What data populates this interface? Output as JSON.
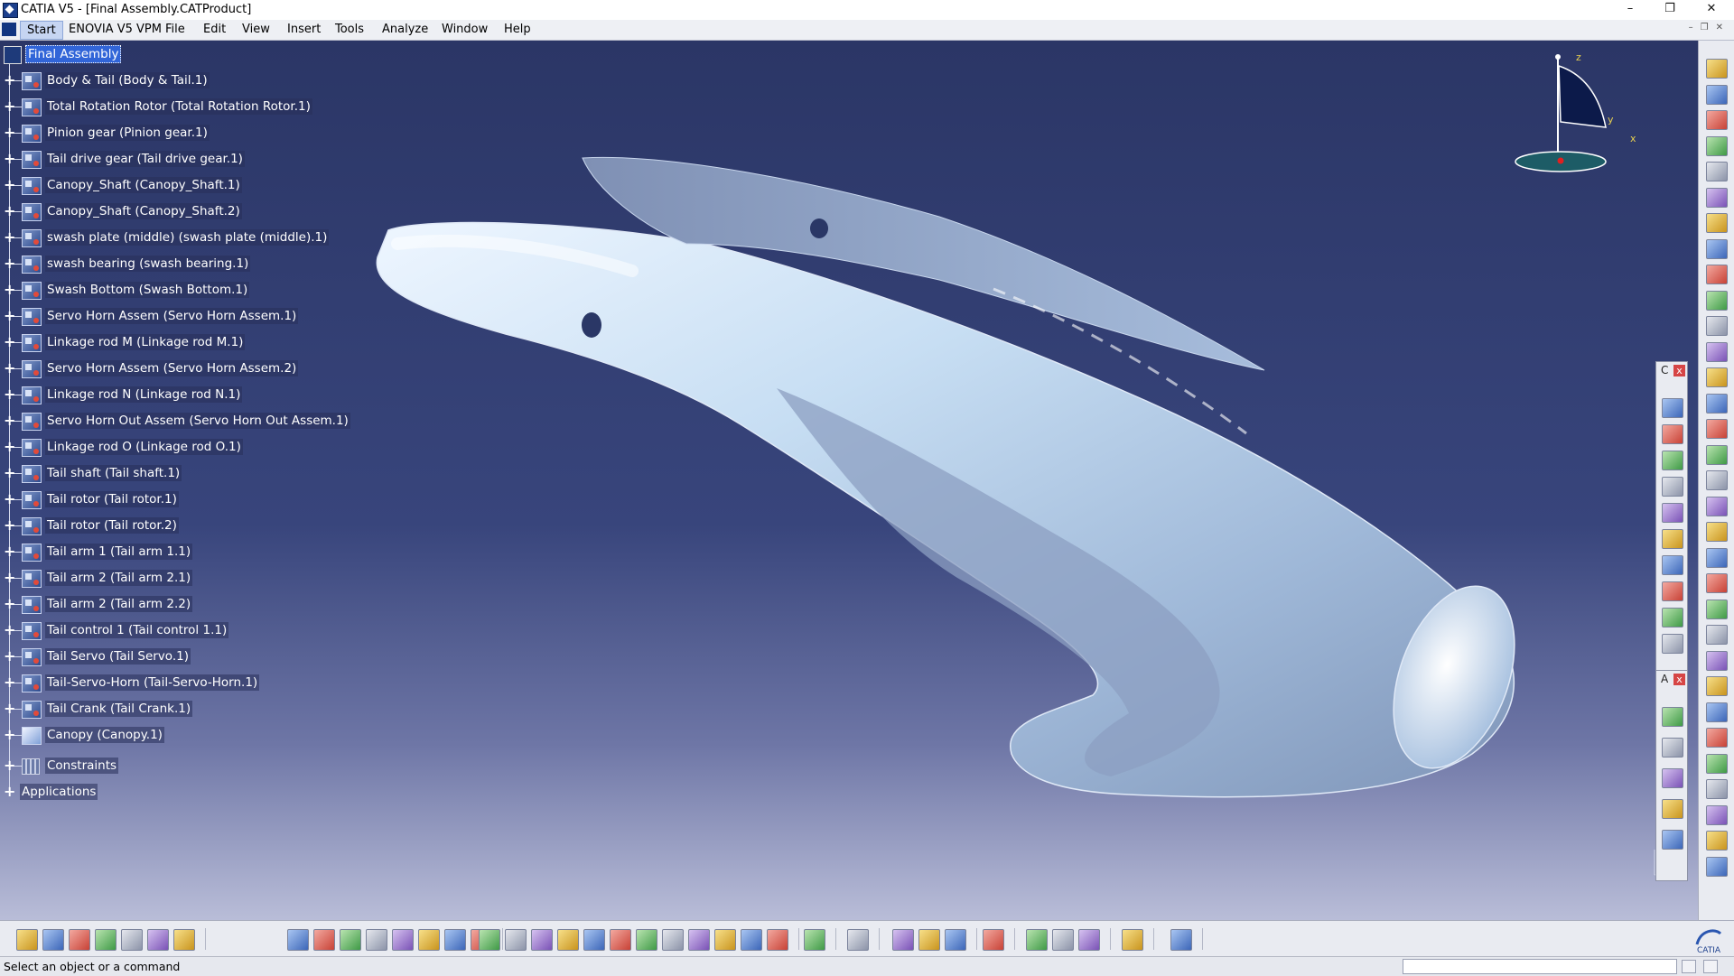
{
  "window": {
    "title": "CATIA V5 - [Final Assembly.CATProduct]",
    "controls": {
      "minimize": "–",
      "maximize": "❐",
      "close": "✕"
    }
  },
  "menu": {
    "items": [
      "Start",
      "ENOVIA V5 VPM",
      "File",
      "Edit",
      "View",
      "Insert",
      "Tools",
      "Analyze",
      "Window",
      "Help"
    ]
  },
  "tree": {
    "root": "Final Assembly",
    "nodes": [
      "Body & Tail (Body & Tail.1)",
      "Total Rotation Rotor (Total Rotation Rotor.1)",
      "Pinion gear (Pinion gear.1)",
      "Tail drive gear (Tail drive gear.1)",
      "Canopy_Shaft (Canopy_Shaft.1)",
      "Canopy_Shaft (Canopy_Shaft.2)",
      "swash plate (middle) (swash plate (middle).1)",
      "swash bearing (swash bearing.1)",
      "Swash Bottom (Swash Bottom.1)",
      "Servo Horn Assem (Servo Horn Assem.1)",
      "Linkage rod M (Linkage rod M.1)",
      "Servo Horn Assem (Servo Horn Assem.2)",
      "Linkage rod N (Linkage rod N.1)",
      "Servo Horn Out Assem (Servo Horn Out Assem.1)",
      "Linkage rod O (Linkage rod O.1)",
      "Tail shaft (Tail shaft.1)",
      "Tail rotor (Tail rotor.1)",
      "Tail rotor (Tail rotor.2)",
      "Tail arm 1 (Tail arm 1.1)",
      "Tail arm 2 (Tail arm 2.1)",
      "Tail arm 2 (Tail arm 2.2)",
      "Tail control 1 (Tail control 1.1)",
      "Tail Servo (Tail Servo.1)",
      "Tail-Servo-Horn (Tail-Servo-Horn.1)",
      "Tail Crank (Tail Crank.1)",
      "Canopy (Canopy.1)"
    ],
    "constraints": "Constraints",
    "applications": "Applications"
  },
  "compass": {
    "z": "z",
    "y": "y",
    "x": "x"
  },
  "floating_toolbars": {
    "first_tag": "C",
    "second_tag": "A",
    "close": "x"
  },
  "status": {
    "text": "Select an object or a command"
  },
  "brand": {
    "label": "CATIA"
  },
  "colors": {
    "viewport_top": "#2b3666",
    "model": "#b9d3ee",
    "selection": "#3165d8"
  }
}
